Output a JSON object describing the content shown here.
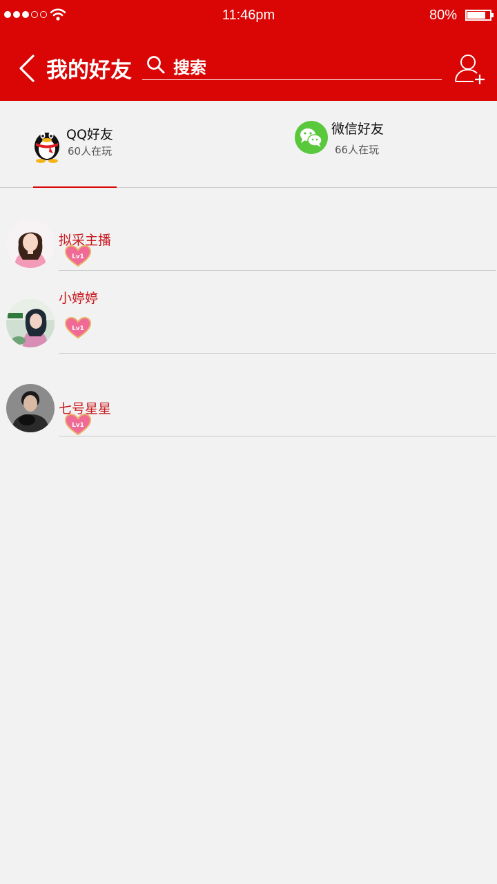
{
  "status_bar": {
    "time": "11:46pm",
    "battery": "80%",
    "battery_level": 0.8,
    "signal_full": 3,
    "signal_total": 5
  },
  "header": {
    "title": "我的好友",
    "search_placeholder": "搜索",
    "back_icon": "chevron-left-icon",
    "add_icon": "add-user-icon"
  },
  "tabs": [
    {
      "name": "QQ好友",
      "count": "60人在玩",
      "icon": "qq-penguin-icon",
      "active": true
    },
    {
      "name": "微信好友",
      "count": "66人在玩",
      "icon": "wechat-icon",
      "active": false
    }
  ],
  "friends": [
    {
      "name": "拟采主播",
      "level": "Lv1"
    },
    {
      "name": "小婷婷",
      "level": "Lv1"
    },
    {
      "name": "七号星星",
      "level": "Lv1"
    }
  ],
  "colors": {
    "brand_red": "#d90605",
    "name_red": "#c8191f",
    "background": "#f2f2f2",
    "wechat_green": "#5ac83c"
  }
}
